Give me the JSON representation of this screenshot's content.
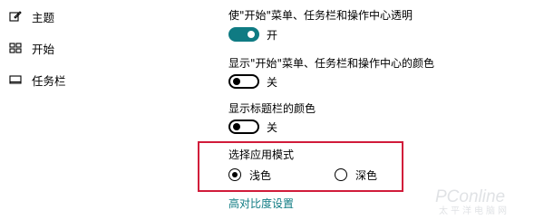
{
  "sidebar": {
    "items": [
      {
        "label": "主题",
        "icon": "theme-brush-icon"
      },
      {
        "label": "开始",
        "icon": "start-menu-icon"
      },
      {
        "label": "任务栏",
        "icon": "taskbar-icon"
      }
    ]
  },
  "settings": {
    "transparency": {
      "label": "使\"开始\"菜单、任务栏和操作中心透明",
      "state": "开",
      "on": true
    },
    "show_start_color": {
      "label": "显示\"开始\"菜单、任务栏和操作中心的颜色",
      "state": "关",
      "on": false
    },
    "show_titlebar_color": {
      "label": "显示标题栏的颜色",
      "state": "关",
      "on": false
    }
  },
  "app_mode": {
    "title": "选择应用模式",
    "options": [
      {
        "label": "浅色",
        "selected": true
      },
      {
        "label": "深色",
        "selected": false
      }
    ]
  },
  "high_contrast_link": "高对比度设置",
  "watermark": {
    "brand": "PConline",
    "tagline": "太平洋电脑网"
  },
  "colors": {
    "accent": "#0f7b83",
    "highlight_box": "#d11b3a"
  }
}
